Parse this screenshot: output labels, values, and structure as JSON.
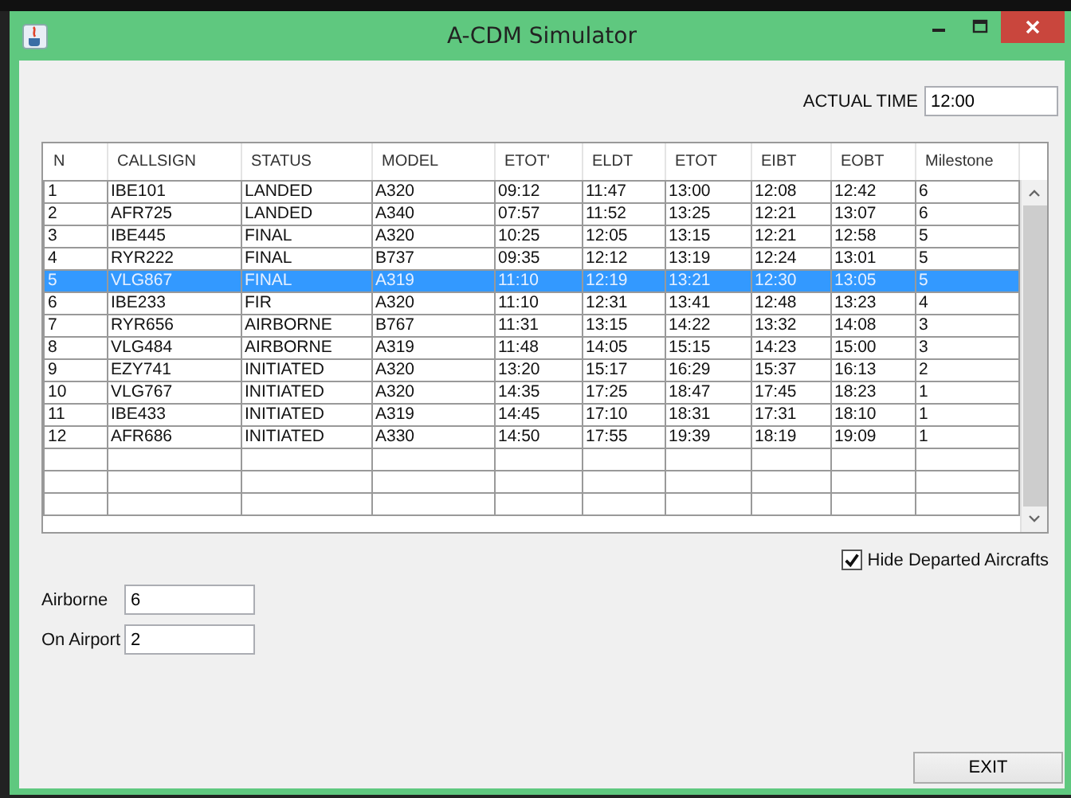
{
  "window": {
    "title": "A-CDM Simulator"
  },
  "actual_time": {
    "label": "ACTUAL TIME",
    "value": "12:00"
  },
  "table": {
    "columns": [
      "N",
      "CALLSIGN",
      "STATUS",
      "MODEL",
      "ETOT'",
      "ELDT",
      "ETOT",
      "EIBT",
      "EOBT",
      "Milestone"
    ],
    "rows": [
      {
        "cells": [
          "1",
          "IBE101",
          "LANDED",
          "A320",
          "09:12",
          "11:47",
          "13:00",
          "12:08",
          "12:42",
          "6"
        ],
        "selected": false
      },
      {
        "cells": [
          "2",
          "AFR725",
          "LANDED",
          "A340",
          "07:57",
          "11:52",
          "13:25",
          "12:21",
          "13:07",
          "6"
        ],
        "selected": false
      },
      {
        "cells": [
          "3",
          "IBE445",
          "FINAL",
          "A320",
          "10:25",
          "12:05",
          "13:15",
          "12:21",
          "12:58",
          "5"
        ],
        "selected": false
      },
      {
        "cells": [
          "4",
          "RYR222",
          "FINAL",
          "B737",
          "09:35",
          "12:12",
          "13:19",
          "12:24",
          "13:01",
          "5"
        ],
        "selected": false
      },
      {
        "cells": [
          "5",
          "VLG867",
          "FINAL",
          "A319",
          "11:10",
          "12:19",
          "13:21",
          "12:30",
          "13:05",
          "5"
        ],
        "selected": true
      },
      {
        "cells": [
          "6",
          "IBE233",
          "FIR",
          "A320",
          "11:10",
          "12:31",
          "13:41",
          "12:48",
          "13:23",
          "4"
        ],
        "selected": false
      },
      {
        "cells": [
          "7",
          "RYR656",
          "AIRBORNE",
          "B767",
          "11:31",
          "13:15",
          "14:22",
          "13:32",
          "14:08",
          "3"
        ],
        "selected": false
      },
      {
        "cells": [
          "8",
          "VLG484",
          "AIRBORNE",
          "A319",
          "11:48",
          "14:05",
          "15:15",
          "14:23",
          "15:00",
          "3"
        ],
        "selected": false
      },
      {
        "cells": [
          "9",
          "EZY741",
          "INITIATED",
          "A320",
          "13:20",
          "15:17",
          "16:29",
          "15:37",
          "16:13",
          "2"
        ],
        "selected": false
      },
      {
        "cells": [
          "10",
          "VLG767",
          "INITIATED",
          "A320",
          "14:35",
          "17:25",
          "18:47",
          "17:45",
          "18:23",
          "1"
        ],
        "selected": false
      },
      {
        "cells": [
          "11",
          "IBE433",
          "INITIATED",
          "A319",
          "14:45",
          "17:10",
          "18:31",
          "17:31",
          "18:10",
          "1"
        ],
        "selected": false
      },
      {
        "cells": [
          "12",
          "AFR686",
          "INITIATED",
          "A330",
          "14:50",
          "17:55",
          "19:39",
          "18:19",
          "19:09",
          "1"
        ],
        "selected": false
      }
    ]
  },
  "hide_departed": {
    "label": "Hide Departed Aircrafts",
    "checked": true
  },
  "counters": [
    {
      "label": "Airborne",
      "value": "6"
    },
    {
      "label": "On Airport",
      "value": "2"
    }
  ],
  "exit_button": "EXIT"
}
